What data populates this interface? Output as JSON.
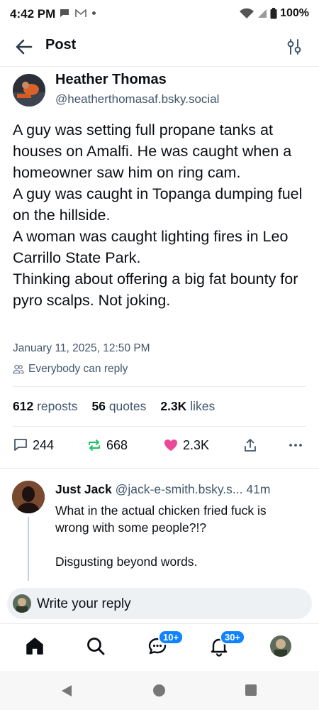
{
  "status_bar": {
    "time": "4:42 PM",
    "battery": "100%"
  },
  "header": {
    "title": "Post"
  },
  "post": {
    "author_name": "Heather Thomas",
    "author_handle": "@heatherthomasaf.bsky.social",
    "text": "A guy was setting full propane tanks at houses on Amalfi. He was caught when a homeowner saw him on ring cam.\nA guy was caught in Topanga dumping fuel on the hillside.\nA woman was caught lighting fires in Leo Carrillo State Park.\nThinking about offering a big fat bounty for pyro scalps. Not joking.",
    "date": "January 11, 2025, 12:50 PM",
    "reply_setting": "Everybody can reply",
    "stats": {
      "reposts_count": "612",
      "reposts_label": "reposts",
      "quotes_count": "56",
      "quotes_label": "quotes",
      "likes_count": "2.3K",
      "likes_label": "likes"
    },
    "actions": {
      "reply_count": "244",
      "repost_count": "668",
      "like_count": "2.3K"
    }
  },
  "reply": {
    "author_name": "Just Jack",
    "author_handle": "@jack-e-smith.bsky.s...",
    "time": "41m",
    "text": "What in the actual chicken fried fuck is wrong with some people?!?\n\nDisgusting beyond words."
  },
  "composer": {
    "placeholder": "Write your reply"
  },
  "nav": {
    "chat_badge": "10+",
    "notif_badge": "30+"
  },
  "colors": {
    "accent": "#1083fe",
    "like": "#ec4899",
    "repost": "#13c261",
    "muted": "#42576c"
  }
}
